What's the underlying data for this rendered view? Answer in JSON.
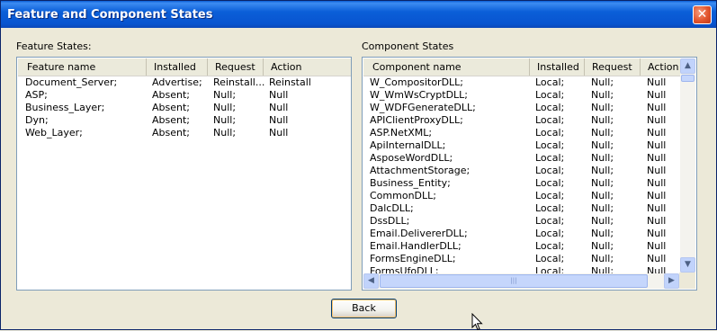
{
  "window": {
    "title": "Feature and Component States",
    "close_label": "✕"
  },
  "feature_states": {
    "label": "Feature States:",
    "columns": [
      "Feature name",
      "Installed",
      "Request",
      "Action"
    ],
    "rows": [
      [
        "Document_Server;",
        "Advertise;",
        "Reinstall...",
        "Reinstall"
      ],
      [
        "ASP;",
        "Absent;",
        "Null;",
        "Null"
      ],
      [
        "Business_Layer;",
        "Absent;",
        "Null;",
        "Null"
      ],
      [
        "Dyn;",
        "Absent;",
        "Null;",
        "Null"
      ],
      [
        "Web_Layer;",
        "Absent;",
        "Null;",
        "Null"
      ]
    ]
  },
  "component_states": {
    "label": "Component States",
    "columns": [
      "Component name",
      "Installed",
      "Request",
      "Action"
    ],
    "rows": [
      [
        "W_CompositorDLL;",
        "Local;",
        "Null;",
        "Null"
      ],
      [
        "W_WmWsCryptDLL;",
        "Local;",
        "Null;",
        "Null"
      ],
      [
        "W_WDFGenerateDLL;",
        "Local;",
        "Null;",
        "Null"
      ],
      [
        "APIClientProxyDLL;",
        "Local;",
        "Null;",
        "Null"
      ],
      [
        "ASP.NetXML;",
        "Local;",
        "Null;",
        "Null"
      ],
      [
        "ApiInternalDLL;",
        "Local;",
        "Null;",
        "Null"
      ],
      [
        "AsposeWordDLL;",
        "Local;",
        "Null;",
        "Null"
      ],
      [
        "AttachmentStorage;",
        "Local;",
        "Null;",
        "Null"
      ],
      [
        "Business_Entity;",
        "Local;",
        "Null;",
        "Null"
      ],
      [
        "CommonDLL;",
        "Local;",
        "Null;",
        "Null"
      ],
      [
        "DalcDLL;",
        "Local;",
        "Null;",
        "Null"
      ],
      [
        "DssDLL;",
        "Local;",
        "Null;",
        "Null"
      ],
      [
        "Email.DelivererDLL;",
        "Local;",
        "Null;",
        "Null"
      ],
      [
        "Email.HandlerDLL;",
        "Local;",
        "Null;",
        "Null"
      ],
      [
        "FormsEngineDLL;",
        "Local;",
        "Null;",
        "Null"
      ],
      [
        "FormsUfoDLL;",
        "Local;",
        "Null;",
        "Null"
      ]
    ]
  },
  "back_button": {
    "label": "Back"
  },
  "icons": {
    "scroll_up": "▲",
    "scroll_down": "▼",
    "scroll_left": "◀",
    "scroll_right": "▶",
    "grip": "|||"
  },
  "colors": {
    "titlebar": "#0a5fd6",
    "dialog_bg": "#ece9d8",
    "list_border": "#7f9db9"
  }
}
